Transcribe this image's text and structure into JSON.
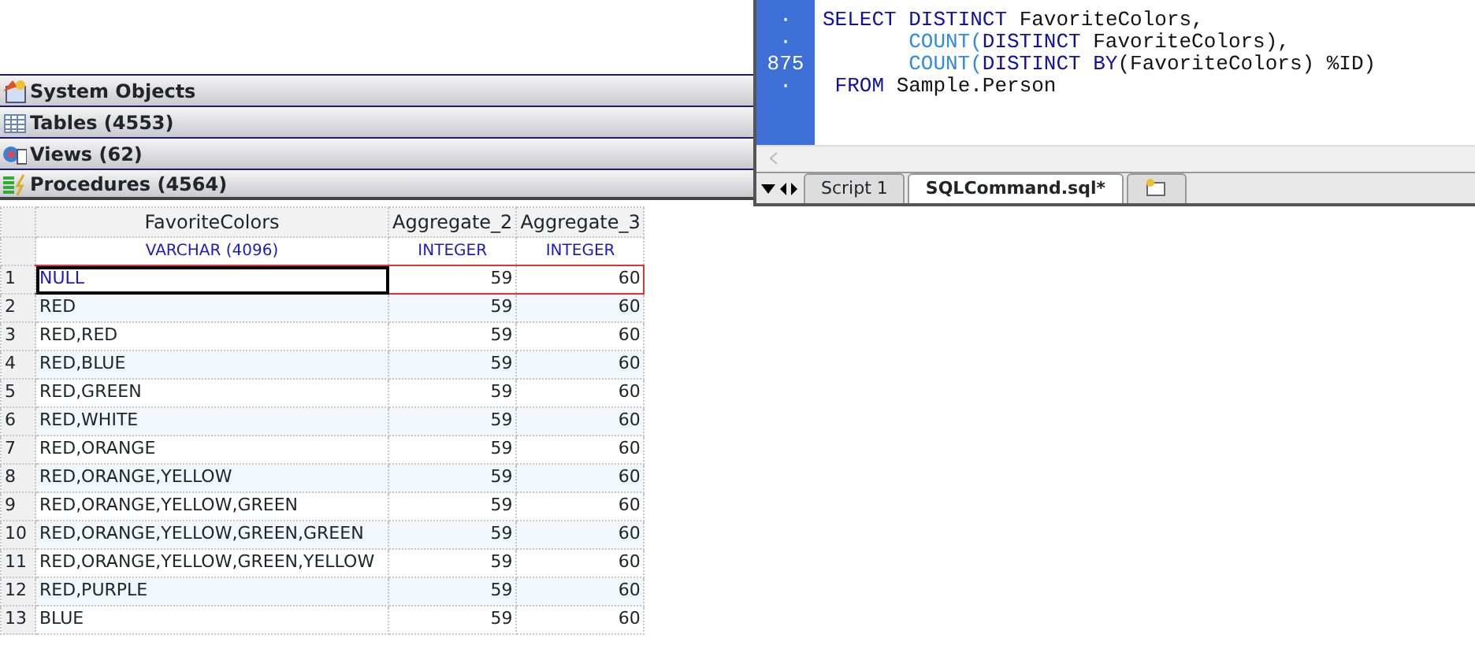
{
  "object_sections": [
    {
      "label": "System Objects"
    },
    {
      "label": "Tables (4553)"
    },
    {
      "label": "Views (62)"
    },
    {
      "label": "Procedures (4564)"
    }
  ],
  "editor": {
    "lines": [
      {
        "gutter": "·",
        "kind": "start",
        "tokens": [
          {
            "kind": "keyword",
            "text": "SELECT DISTINCT"
          },
          {
            "kind": "plain",
            "text": " FavoriteColors,"
          }
        ]
      },
      {
        "gutter": "·",
        "kind": "continuation",
        "tokens": [
          {
            "kind": "function",
            "text": "COUNT("
          },
          {
            "kind": "keyword",
            "text": "DISTINCT"
          },
          {
            "kind": "plain",
            "text": " FavoriteColors),"
          }
        ]
      },
      {
        "gutter": "875",
        "kind": "continuation",
        "tokens": [
          {
            "kind": "function",
            "text": "COUNT("
          },
          {
            "kind": "keyword",
            "text": "DISTINCT BY"
          },
          {
            "kind": "plain",
            "text": "(FavoriteColors) %ID)"
          }
        ]
      },
      {
        "gutter": "·",
        "kind": "clause",
        "tokens": [
          {
            "kind": "keyword",
            "text": "FROM"
          },
          {
            "kind": "plain",
            "text": " Sample.Person"
          }
        ]
      }
    ],
    "tabs": [
      {
        "label": "Script 1",
        "selected": false
      },
      {
        "label": "SQLCommand.sql*",
        "selected": true
      }
    ]
  },
  "results": {
    "columns": [
      {
        "name": "FavoriteColors",
        "type": "VARCHAR (4096)"
      },
      {
        "name": "Aggregate_2",
        "type": "INTEGER"
      },
      {
        "name": "Aggregate_3",
        "type": "INTEGER"
      }
    ],
    "rows": [
      {
        "number": "1",
        "selected": true,
        "cells": [
          {
            "text": "NULL",
            "kind": "null"
          },
          {
            "text": "59",
            "kind": "number"
          },
          {
            "text": "60",
            "kind": "number"
          }
        ]
      },
      {
        "number": "2",
        "selected": false,
        "cells": [
          {
            "text": "RED",
            "kind": "text"
          },
          {
            "text": "59",
            "kind": "number"
          },
          {
            "text": "60",
            "kind": "number"
          }
        ]
      },
      {
        "number": "3",
        "selected": false,
        "cells": [
          {
            "text": "RED,RED",
            "kind": "text"
          },
          {
            "text": "59",
            "kind": "number"
          },
          {
            "text": "60",
            "kind": "number"
          }
        ]
      },
      {
        "number": "4",
        "selected": false,
        "cells": [
          {
            "text": "RED,BLUE",
            "kind": "text"
          },
          {
            "text": "59",
            "kind": "number"
          },
          {
            "text": "60",
            "kind": "number"
          }
        ]
      },
      {
        "number": "5",
        "selected": false,
        "cells": [
          {
            "text": "RED,GREEN",
            "kind": "text"
          },
          {
            "text": "59",
            "kind": "number"
          },
          {
            "text": "60",
            "kind": "number"
          }
        ]
      },
      {
        "number": "6",
        "selected": false,
        "cells": [
          {
            "text": "RED,WHITE",
            "kind": "text"
          },
          {
            "text": "59",
            "kind": "number"
          },
          {
            "text": "60",
            "kind": "number"
          }
        ]
      },
      {
        "number": "7",
        "selected": false,
        "cells": [
          {
            "text": "RED,ORANGE",
            "kind": "text"
          },
          {
            "text": "59",
            "kind": "number"
          },
          {
            "text": "60",
            "kind": "number"
          }
        ]
      },
      {
        "number": "8",
        "selected": false,
        "cells": [
          {
            "text": "RED,ORANGE,YELLOW",
            "kind": "text"
          },
          {
            "text": "59",
            "kind": "number"
          },
          {
            "text": "60",
            "kind": "number"
          }
        ]
      },
      {
        "number": "9",
        "selected": false,
        "cells": [
          {
            "text": "RED,ORANGE,YELLOW,GREEN",
            "kind": "text"
          },
          {
            "text": "59",
            "kind": "number"
          },
          {
            "text": "60",
            "kind": "number"
          }
        ]
      },
      {
        "number": "10",
        "selected": false,
        "cells": [
          {
            "text": "RED,ORANGE,YELLOW,GREEN,GREEN",
            "kind": "text"
          },
          {
            "text": "59",
            "kind": "number"
          },
          {
            "text": "60",
            "kind": "number"
          }
        ]
      },
      {
        "number": "11",
        "selected": false,
        "cells": [
          {
            "text": "RED,ORANGE,YELLOW,GREEN,YELLOW",
            "kind": "text"
          },
          {
            "text": "59",
            "kind": "number"
          },
          {
            "text": "60",
            "kind": "number"
          }
        ]
      },
      {
        "number": "12",
        "selected": false,
        "cells": [
          {
            "text": "RED,PURPLE",
            "kind": "text"
          },
          {
            "text": "59",
            "kind": "number"
          },
          {
            "text": "60",
            "kind": "number"
          }
        ]
      },
      {
        "number": "13",
        "selected": false,
        "cells": [
          {
            "text": "BLUE",
            "kind": "text"
          },
          {
            "text": "59",
            "kind": "number"
          },
          {
            "text": "60",
            "kind": "number"
          }
        ]
      }
    ]
  }
}
